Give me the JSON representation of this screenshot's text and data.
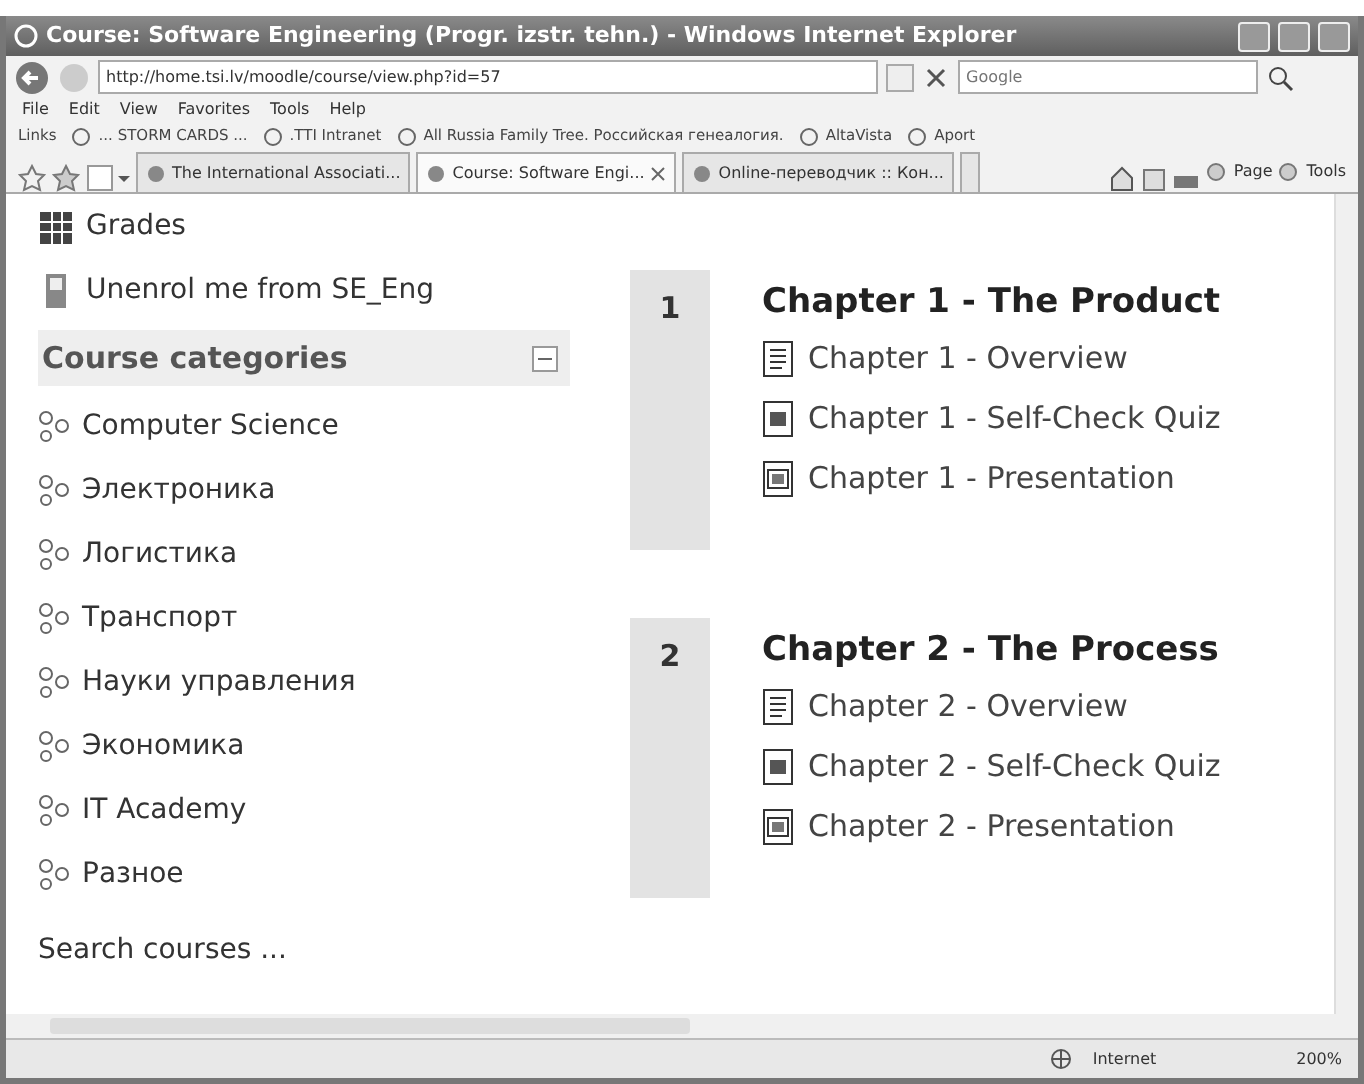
{
  "window": {
    "title": "Course: Software Engineering (Progr. izstr. tehn.) - Windows Internet Explorer"
  },
  "address": {
    "url": "http://home.tsi.lv/moodle/course/view.php?id=57"
  },
  "search": {
    "placeholder": "Google"
  },
  "menu": [
    "File",
    "Edit",
    "View",
    "Favorites",
    "Tools",
    "Help"
  ],
  "links": {
    "label": "Links",
    "items": [
      "... STORM CARDS ...",
      ".TTI Intranet",
      "All Russia Family Tree. Российская генеалогия.",
      "AltaVista",
      "Aport"
    ]
  },
  "tabs": [
    {
      "label": "The International Associati...",
      "selected": false
    },
    {
      "label": "Course: Software Engi...",
      "selected": true
    },
    {
      "label": "Online-переводчик :: Кон...",
      "selected": false
    }
  ],
  "toolbar": [
    "Page",
    "Tools"
  ],
  "sidebar": {
    "items": [
      {
        "kind": "grades",
        "label": "Grades"
      },
      {
        "kind": "unenrol",
        "label": "Unenrol me from SE_Eng"
      }
    ],
    "categories": {
      "title": "Course categories",
      "expanded": true,
      "items": [
        "Computer Science",
        "Электроника",
        "Логистика",
        "Транспорт",
        "Науки управления",
        "Экономика",
        "IT Academy",
        "Разное"
      ]
    },
    "search_link": "Search courses ..."
  },
  "sections": [
    {
      "number": "1",
      "title": "Chapter 1 - The Product",
      "activities": [
        {
          "kind": "page",
          "label": "Chapter 1 - Overview"
        },
        {
          "kind": "quiz",
          "label": "Chapter 1 - Self-Check Quiz"
        },
        {
          "kind": "presentation",
          "label": "Chapter 1 - Presentation"
        }
      ]
    },
    {
      "number": "2",
      "title": "Chapter 2 - The Process",
      "activities": [
        {
          "kind": "page",
          "label": "Chapter 2 - Overview"
        },
        {
          "kind": "quiz",
          "label": "Chapter 2 - Self-Check Quiz"
        },
        {
          "kind": "presentation",
          "label": "Chapter 2 - Presentation"
        }
      ]
    }
  ],
  "status_bar": {
    "zone": "Internet",
    "zoom": "200%"
  }
}
